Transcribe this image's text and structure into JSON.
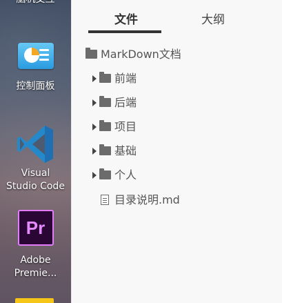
{
  "desktop": {
    "top_partial_label": "脑机交互",
    "icons": [
      {
        "label": "控制面板"
      },
      {
        "label_line1": "Visual",
        "label_line2": "Studio Code"
      },
      {
        "label_line1": "Adobe",
        "label_line2": "Premie..."
      }
    ],
    "premiere_text": "Pr"
  },
  "panel": {
    "tabs": [
      {
        "label": "文件",
        "active": true
      },
      {
        "label": "大纲",
        "active": false
      }
    ],
    "tree": {
      "root": "MarkDown文档",
      "folders": [
        "前端",
        "后端",
        "项目",
        "基础",
        "个人"
      ],
      "files": [
        "目录说明.md"
      ]
    }
  },
  "colors": {
    "panel_bg": "#f8f8f8",
    "active_tab_underline": "#333333",
    "icon_gray": "#6b6b6b",
    "vscode_blue": "#2489ca",
    "premiere_purple": "#e37bff"
  }
}
